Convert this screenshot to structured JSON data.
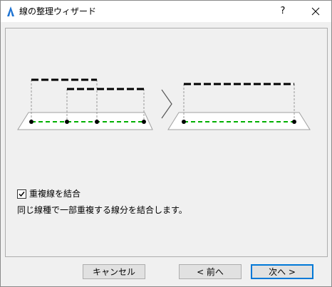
{
  "window": {
    "title": "線の整理ウィザード",
    "help_label": "?"
  },
  "options": {
    "merge_checkbox_label": "重複線を結合",
    "merge_checked": true,
    "description": "同じ線種で一部重複する線分を結合します。"
  },
  "buttons": {
    "cancel": "キャンセル",
    "back": "< 前へ",
    "next": "次へ >"
  },
  "colors": {
    "dash_top": "#000000",
    "dash_base": "#00b000",
    "accent": "#0078d7"
  }
}
